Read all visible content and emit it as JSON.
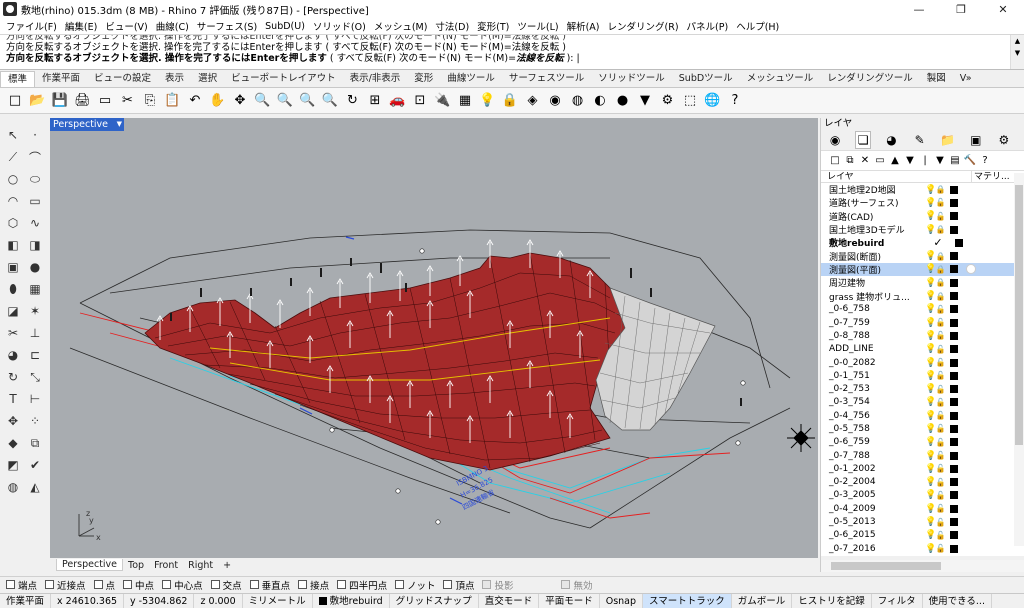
{
  "window": {
    "title": "敷地(rhino) 015.3dm (8 MB) - Rhino 7 評価版 (残り87日) - [Perspective]",
    "minimize": "—",
    "maximize": "❐",
    "close": "✕"
  },
  "menu": [
    "ファイル(F)",
    "編集(E)",
    "ビュー(V)",
    "曲線(C)",
    "サーフェス(S)",
    "SubD(U)",
    "ソリッド(O)",
    "メッシュ(M)",
    "寸法(D)",
    "変形(T)",
    "ツール(L)",
    "解析(A)",
    "レンダリング(R)",
    "パネル(P)",
    "ヘルプ(H)"
  ],
  "command": {
    "history": [
      "方向を反転するオブジェクトを選択. 操作を完了するにはEnterを押します ( すべて反転(F)  次のモード(N)  モード(M)=法線を反転 )",
      "方向を反転するオブジェクトを選択. 操作を完了するにはEnterを押します ( すべて反転(F)  次のモード(N)  モード(M)=法線を反転 )"
    ],
    "prompt_main": "方向を反転するオブジェクトを選択. 操作を完了するにはEnterを押します",
    "prompt_opts": " ( すべて反転(F)  次のモード(N)  モード(M)=",
    "prompt_mode": "法線を反転",
    "prompt_end": " ): |"
  },
  "tabs": [
    "標準",
    "作業平面",
    "ビューの設定",
    "表示",
    "選択",
    "ビューポートレイアウト",
    "表示/非表示",
    "変形",
    "曲線ツール",
    "サーフェスツール",
    "ソリッドツール",
    "SubDツール",
    "メッシュツール",
    "レンダリングツール",
    "製図",
    "V»"
  ],
  "toolbar_icons": [
    "□",
    "📂",
    "💾",
    "🖨",
    "▭",
    "✂",
    "⎘",
    "📋",
    "↶",
    "✋",
    "✥",
    "🔍",
    "🔍",
    "🔍",
    "🔍",
    "↻",
    "⊞",
    "🚗",
    "⊡",
    "🔌",
    "▦",
    "💡",
    "🔒",
    "◈",
    "◉",
    "◍",
    "◐",
    "●",
    "▼",
    "⚙",
    "⬚",
    "🌐",
    "?"
  ],
  "viewport": {
    "name": "Perspective",
    "axis_x": "x",
    "axis_y": "y",
    "axis_z": "z",
    "annotation_1": "ISBMNO 3",
    "annotation_2": "H=36.825",
    "annotation_3": "四国連輸省"
  },
  "viewport_tabs": [
    "Perspective",
    "Top",
    "Front",
    "Right",
    "+"
  ],
  "layer_panel": {
    "title": "レイヤ",
    "col_layer": "レイヤ",
    "col_material": "マテリ...",
    "layers": [
      {
        "name": "国土地理2D地図",
        "vis": "blue",
        "lock": "locked"
      },
      {
        "name": "道路(サーフェス)",
        "vis": "blue",
        "lock": "open"
      },
      {
        "name": "道路(CAD)",
        "vis": "blue",
        "lock": "open"
      },
      {
        "name": "国土地理3Dモデル",
        "vis": "blue",
        "lock": "locked"
      },
      {
        "name": "敷地rebuird",
        "vis": "none",
        "lock": "none",
        "current": true
      },
      {
        "name": "測量図(断面)",
        "vis": "yellow",
        "lock": "locked"
      },
      {
        "name": "測量図(平面)",
        "vis": "yellow",
        "lock": "locked",
        "selected": true
      },
      {
        "name": "周辺建物",
        "vis": "blue",
        "lock": "locked"
      },
      {
        "name": "grass 建物ボリュ...",
        "vis": "blue",
        "lock": "locked"
      },
      {
        "name": "_0-6_758",
        "vis": "yellow",
        "lock": "open"
      },
      {
        "name": "_0-7_759",
        "vis": "yellow",
        "lock": "open"
      },
      {
        "name": "_0-8_788",
        "vis": "yellow",
        "lock": "open"
      },
      {
        "name": "ADD_LINE",
        "vis": "yellow",
        "lock": "open"
      },
      {
        "name": "_0-0_2082",
        "vis": "yellow",
        "lock": "open"
      },
      {
        "name": "_0-1_751",
        "vis": "yellow",
        "lock": "open"
      },
      {
        "name": "_0-2_753",
        "vis": "yellow",
        "lock": "open"
      },
      {
        "name": "_0-3_754",
        "vis": "yellow",
        "lock": "open"
      },
      {
        "name": "_0-4_756",
        "vis": "yellow",
        "lock": "open"
      },
      {
        "name": "_0-5_758",
        "vis": "yellow",
        "lock": "open"
      },
      {
        "name": "_0-6_759",
        "vis": "yellow",
        "lock": "open"
      },
      {
        "name": "_0-7_788",
        "vis": "yellow",
        "lock": "open"
      },
      {
        "name": "_0-1_2002",
        "vis": "yellow",
        "lock": "open"
      },
      {
        "name": "_0-2_2004",
        "vis": "yellow",
        "lock": "open"
      },
      {
        "name": "_0-3_2005",
        "vis": "yellow",
        "lock": "open"
      },
      {
        "name": "_0-4_2009",
        "vis": "yellow",
        "lock": "open"
      },
      {
        "name": "_0-5_2013",
        "vis": "yellow",
        "lock": "open"
      },
      {
        "name": "_0-6_2015",
        "vis": "yellow",
        "lock": "open"
      },
      {
        "name": "_0-7_2016",
        "vis": "yellow",
        "lock": "open"
      }
    ]
  },
  "osnap": [
    {
      "label": "端点",
      "enabled": true
    },
    {
      "label": "近接点",
      "enabled": true
    },
    {
      "label": "点",
      "enabled": true
    },
    {
      "label": "中点",
      "enabled": true
    },
    {
      "label": "中心点",
      "enabled": true
    },
    {
      "label": "交点",
      "enabled": true
    },
    {
      "label": "垂直点",
      "enabled": true
    },
    {
      "label": "接点",
      "enabled": true
    },
    {
      "label": "四半円点",
      "enabled": true
    },
    {
      "label": "ノット",
      "enabled": true
    },
    {
      "label": "頂点",
      "enabled": true
    },
    {
      "label": "投影",
      "enabled": false
    },
    {
      "label": "無効",
      "enabled": false
    }
  ],
  "status": {
    "cplane": "作業平面",
    "x": "x 24610.365",
    "y": "y -5304.862",
    "z": "z 0.000",
    "units": "ミリメートル",
    "layer": "敷地rebuird",
    "grid_snap": "グリッドスナップ",
    "ortho": "直交モード",
    "planar": "平面モード",
    "osnap": "Osnap",
    "smarttrack": "スマートトラック",
    "gumball": "ガムボール",
    "history": "ヒストリを記録",
    "filter": "フィルタ",
    "usage": "使用できる..."
  },
  "colors": {
    "accent": "#2f64c8",
    "surface_red": "#a52a2a",
    "viewport_bg": "#a8acb0",
    "selection": "#b9d3f5"
  }
}
